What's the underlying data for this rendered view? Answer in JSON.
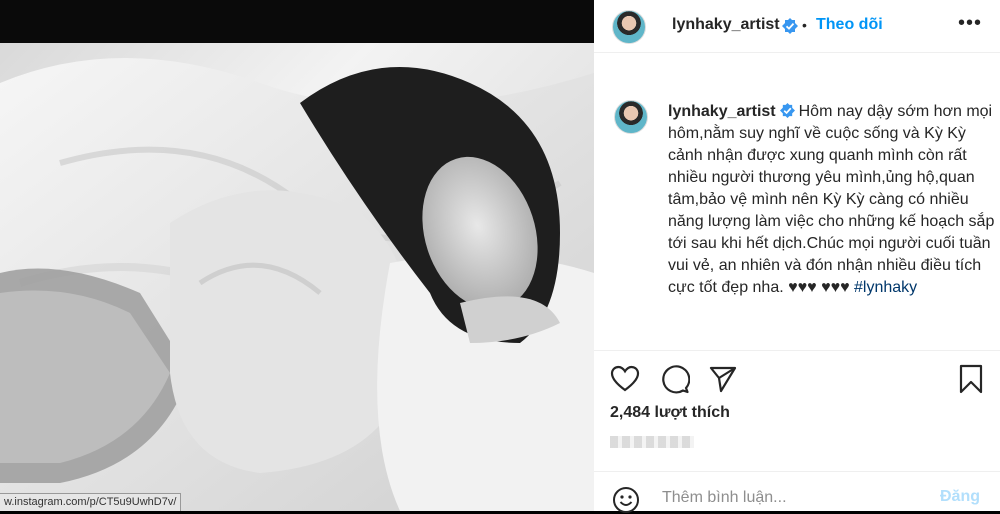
{
  "post": {
    "username": "lynhaky_artist",
    "follow_label": "Theo dõi",
    "separator": "•",
    "more_label": "•••",
    "caption": "Hôm nay dậy sớm hơn mọi hôm,nằm suy nghĩ về cuộc sống và Kỳ Kỳ cảnh nhận được xung quanh mình còn rất nhiều người thương yêu mình,ủng hộ,quan tâm,bảo vệ mình nên Kỳ Kỳ càng có nhiều năng lượng làm việc cho những kế hoạch sắp tới sau khi hết dịch.Chúc mọi người cuối tuần vui vẻ, an nhiên và đón nhận nhiều điều tích cực tốt đẹp nha. ♥♥♥ ♥♥♥",
    "hashtag": "#lynhaky",
    "likes": "2,484 lượt thích"
  },
  "comment": {
    "placeholder": "Thêm bình luận...",
    "post_label": "Đăng"
  },
  "browser": {
    "status_url": "w.instagram.com/p/CT5u9UwhD7v/"
  },
  "icons": {
    "verified": "verified-badge-icon",
    "like": "heart-icon",
    "comment": "comment-bubble-icon",
    "share": "paper-plane-icon",
    "save": "bookmark-icon",
    "emoji": "smiley-icon"
  },
  "colors": {
    "accent": "#0095f6",
    "post_disabled": "#b2dffc",
    "text": "#262626",
    "muted": "#8e8e8e",
    "hashtag": "#00376b"
  }
}
